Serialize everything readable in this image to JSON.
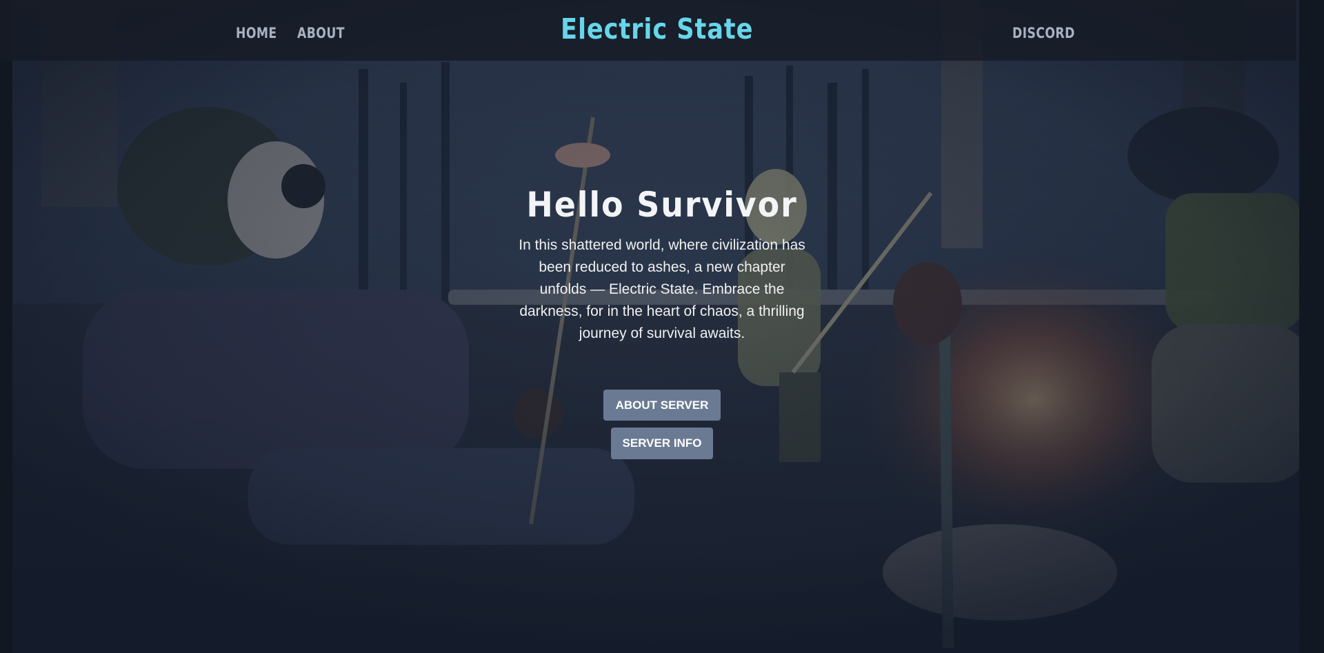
{
  "nav": {
    "home": "HOME",
    "about": "ABOUT",
    "brand": "Electric State",
    "discord": "DISCORD"
  },
  "hero": {
    "title": "Hello Survivor",
    "body": "In this shattered world, where civilization has been reduced to ashes, a new chapter unfolds — Electric State. Embrace the darkness, for in the heart of chaos, a thrilling journey of survival awaits.",
    "about_button": "ABOUT SERVER",
    "info_button": "SERVER INFO"
  },
  "colors": {
    "brand": "#67d6ea",
    "button": "#6b7a93",
    "nav_text": "#a9b2c0",
    "navbar_bg": "#161b24"
  }
}
